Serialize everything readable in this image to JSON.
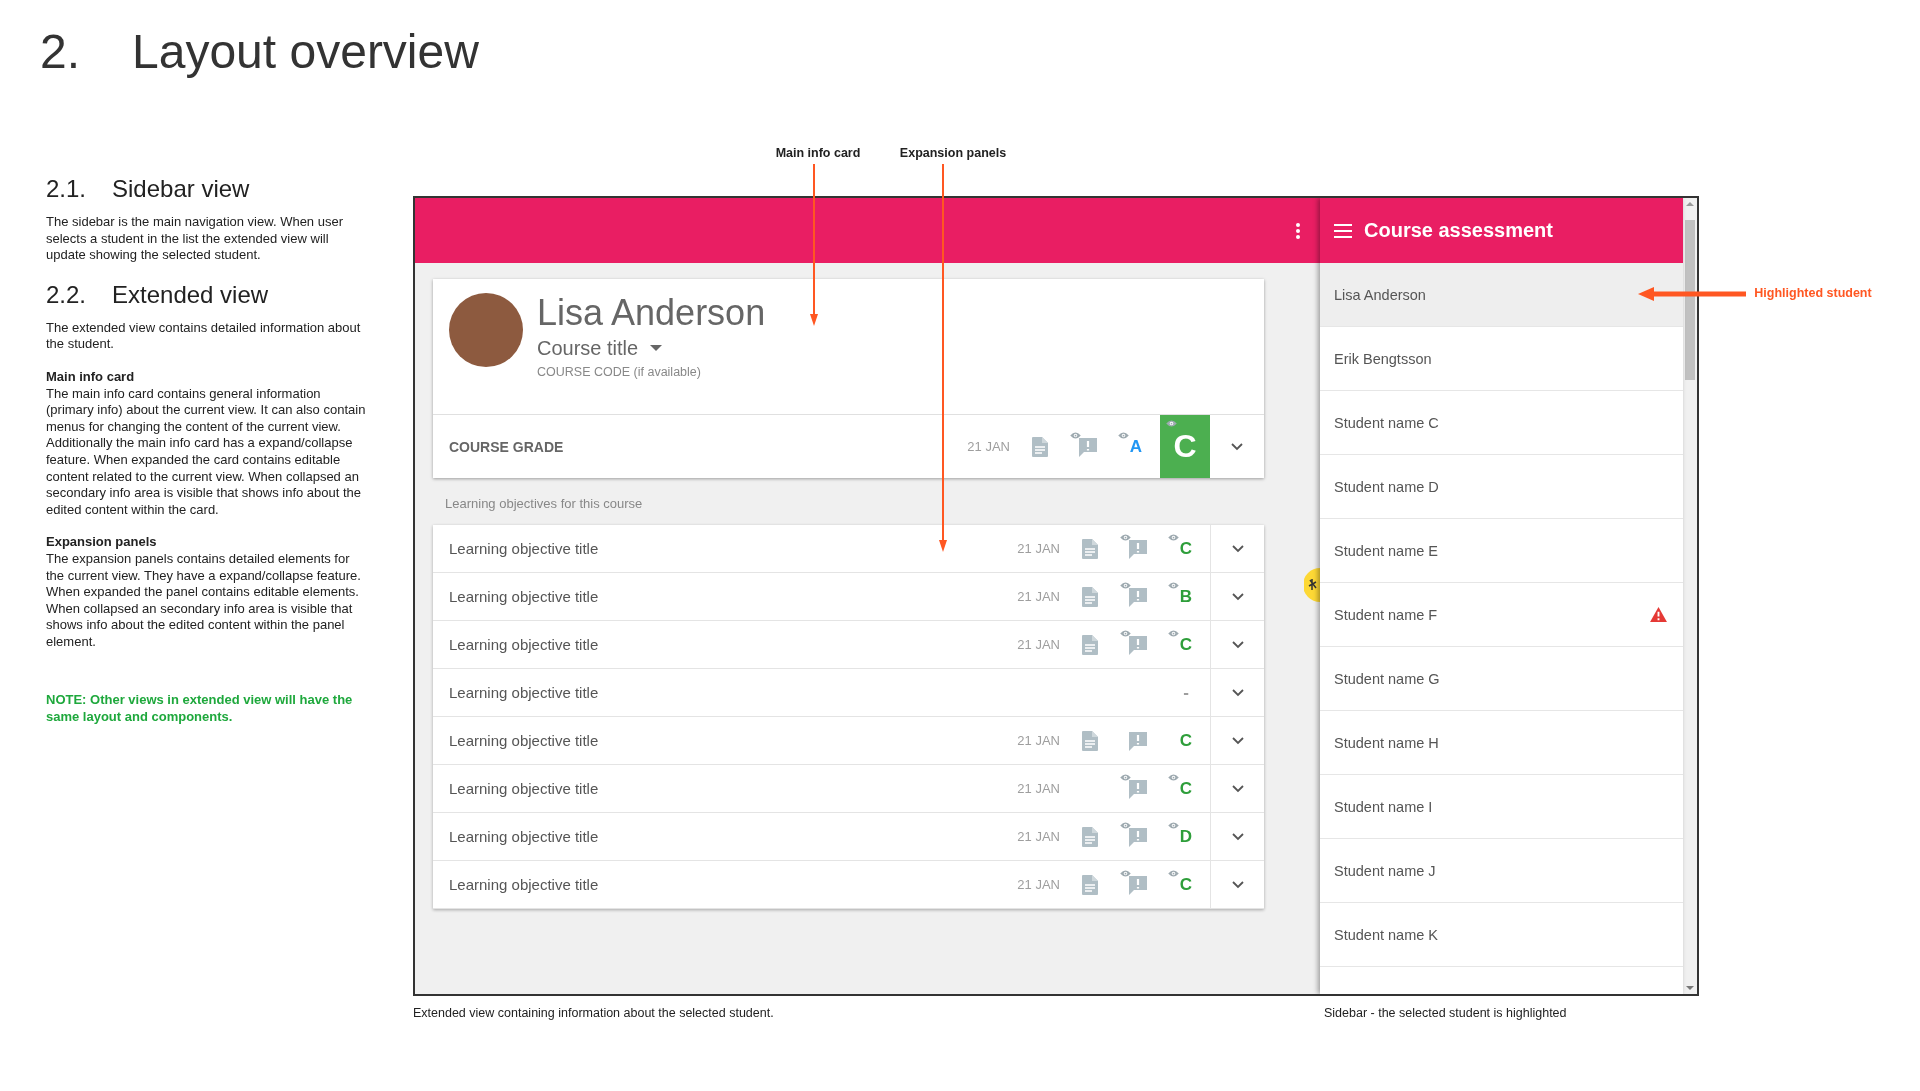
{
  "page_title": {
    "number": "2.",
    "text": "Layout overview"
  },
  "sections": [
    {
      "number": "2.1.",
      "title": "Sidebar view",
      "blocks": [
        {
          "text": "The sidebar is the main navigation view. When user selects a student in the list the extended view will update showing the selected student."
        }
      ]
    },
    {
      "number": "2.2.",
      "title": "Extended view",
      "blocks": [
        {
          "text": "The extended view contains detailed information about the student."
        },
        {
          "heading": "Main info card",
          "text": "The main info card contains general information (primary info) about the current view. It can also contain menus for changing the content of the current view. Additionally the main info card has a expand/collapse feature. When expanded the card contains editable content related to the current view. When collapsed an secondary info area is visible that shows info about the edited content within the card."
        },
        {
          "heading": "Expansion panels",
          "text": "The expansion panels contains detailed elements for the current view. They have a expand/collapse feature. When expanded the panel contains editable elements. When collapsed an secondary info area is visible that shows info about the edited content within the panel element."
        }
      ]
    }
  ],
  "note": "NOTE: Other views in extended view will have the same layout and components.",
  "annotations": {
    "main_info_card": "Main info card",
    "expansion_panels": "Expansion panels",
    "highlighted_student": "Highlighted student"
  },
  "card": {
    "name": "Lisa Anderson",
    "course_title": "Course title",
    "course_code": "COURSE CODE (if available)",
    "grade_label": "COURSE GRADE",
    "date": "21 JAN",
    "document": true,
    "comment": true,
    "comment_seen": true,
    "secondary_grade": {
      "letter": "A",
      "seen": true,
      "color": "#2196f3"
    },
    "grade": {
      "letter": "C",
      "seen": true,
      "color": "#4caf50"
    }
  },
  "objectives_label": "Learning objectives for this course",
  "objectives": [
    {
      "title": "Learning objective title",
      "date": "21 JAN",
      "document": true,
      "comment": true,
      "comment_seen": true,
      "grade": "C",
      "grade_seen": true,
      "color": "#2e9e3a"
    },
    {
      "title": "Learning objective title",
      "date": "21 JAN",
      "document": true,
      "comment": true,
      "comment_seen": true,
      "grade": "B",
      "grade_seen": true,
      "color": "#2e9e3a"
    },
    {
      "title": "Learning objective title",
      "date": "21 JAN",
      "document": true,
      "comment": true,
      "comment_seen": true,
      "grade": "C",
      "grade_seen": true,
      "color": "#2e9e3a"
    },
    {
      "title": "Learning objective title",
      "document": false,
      "comment": false,
      "comment_seen": false,
      "grade": "-",
      "grade_seen": false,
      "color": "#9e9e9e"
    },
    {
      "title": "Learning objective title",
      "date": "21 JAN",
      "document": true,
      "comment": true,
      "comment_seen": false,
      "grade": "C",
      "grade_seen": false,
      "color": "#2e9e3a"
    },
    {
      "title": "Learning objective title",
      "date": "21 JAN",
      "document": false,
      "comment": true,
      "comment_seen": true,
      "grade": "C",
      "grade_seen": true,
      "color": "#2e9e3a"
    },
    {
      "title": "Learning objective title",
      "date": "21 JAN",
      "document": true,
      "comment": true,
      "comment_seen": true,
      "grade": "D",
      "grade_seen": true,
      "color": "#2e9e3a"
    },
    {
      "title": "Learning objective title",
      "date": "21 JAN",
      "document": true,
      "comment": true,
      "comment_seen": true,
      "grade": "C",
      "grade_seen": true,
      "color": "#2e9e3a"
    }
  ],
  "sidebar": {
    "title": "Course assessment",
    "students": [
      {
        "name": "Lisa Anderson",
        "selected": true,
        "warning": false
      },
      {
        "name": "Erik Bengtsson",
        "selected": false,
        "warning": false
      },
      {
        "name": "Student name C",
        "selected": false,
        "warning": false
      },
      {
        "name": "Student name D",
        "selected": false,
        "warning": false
      },
      {
        "name": "Student name E",
        "selected": false,
        "warning": false
      },
      {
        "name": "Student name F",
        "selected": false,
        "warning": true
      },
      {
        "name": "Student name G",
        "selected": false,
        "warning": false
      },
      {
        "name": "Student name H",
        "selected": false,
        "warning": false
      },
      {
        "name": "Student name I",
        "selected": false,
        "warning": false
      },
      {
        "name": "Student name J",
        "selected": false,
        "warning": false
      },
      {
        "name": "Student name K",
        "selected": false,
        "warning": false
      }
    ]
  },
  "captions": [
    "Extended view containing information about the selected student.",
    "Sidebar - the selected student is highlighted"
  ]
}
